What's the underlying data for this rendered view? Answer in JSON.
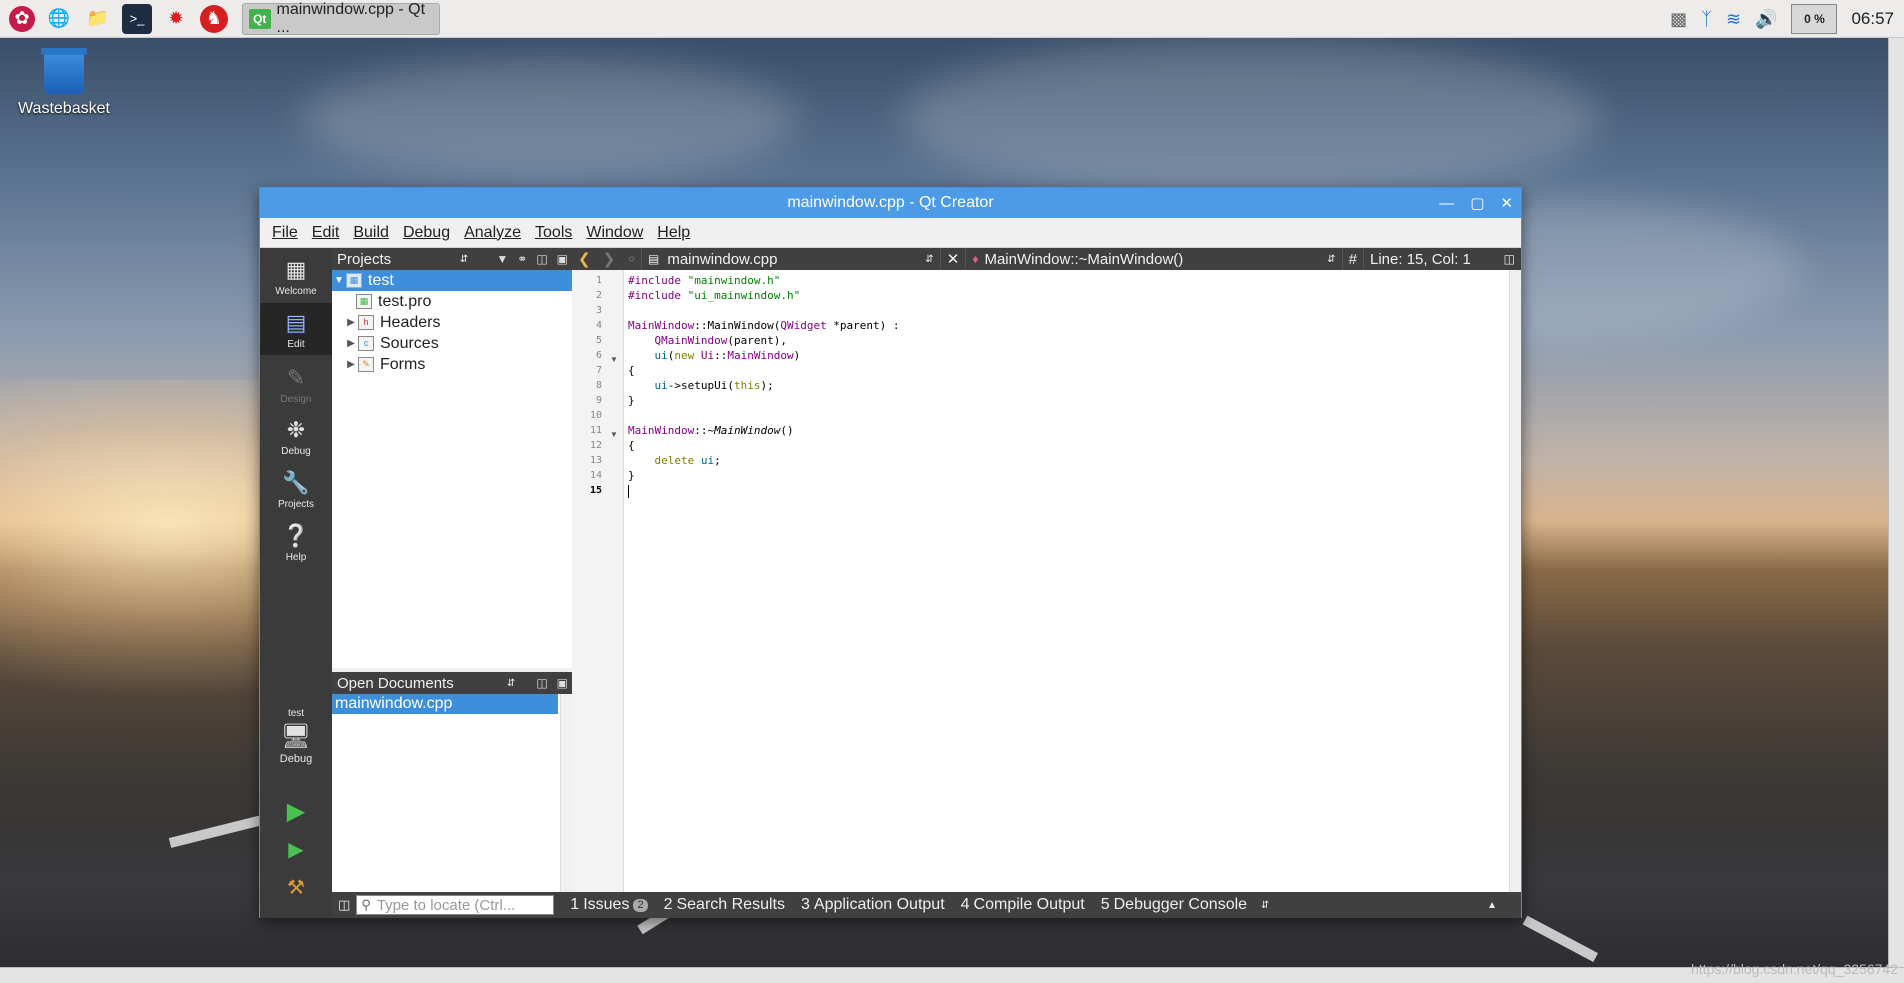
{
  "taskbar": {
    "launchers": [
      "raspberry-menu-icon",
      "web-browser-icon",
      "file-manager-icon",
      "terminal-icon",
      "math-icon",
      "wolfram-icon"
    ],
    "task_icon": "Qt",
    "task_label": "mainwindow.cpp - Qt ...",
    "cpu": "0 %",
    "clock": "06:57"
  },
  "desktop": {
    "icon_label": "Wastebasket"
  },
  "window": {
    "title": "mainwindow.cpp - Qt Creator",
    "menu": [
      "File",
      "Edit",
      "Build",
      "Debug",
      "Analyze",
      "Tools",
      "Window",
      "Help"
    ]
  },
  "modes": [
    {
      "label": "Welcome"
    },
    {
      "label": "Edit"
    },
    {
      "label": "Design"
    },
    {
      "label": "Debug"
    },
    {
      "label": "Projects"
    },
    {
      "label": "Help"
    }
  ],
  "kit": {
    "project": "test",
    "config": "Debug"
  },
  "projects_panel": {
    "title": "Projects",
    "tree": [
      {
        "label": "test"
      },
      {
        "label": "test.pro"
      },
      {
        "label": "Headers"
      },
      {
        "label": "Sources"
      },
      {
        "label": "Forms"
      }
    ]
  },
  "open_docs": {
    "title": "Open Documents",
    "items": [
      "mainwindow.cpp"
    ]
  },
  "editor": {
    "file": "mainwindow.cpp",
    "symbol": "MainWindow::~MainWindow()",
    "hash": "#",
    "position": "Line: 15, Col: 1",
    "line_numbers": [
      "1",
      "2",
      "3",
      "4",
      "5",
      "6",
      "7",
      "8",
      "9",
      "10",
      "11",
      "12",
      "13",
      "14",
      "15"
    ]
  },
  "locator": {
    "placeholder": "Type to locate (Ctrl..."
  },
  "output_tabs": [
    {
      "num": "1",
      "label": "Issues",
      "badge": "2"
    },
    {
      "num": "2",
      "label": "Search Results"
    },
    {
      "num": "3",
      "label": "Application Output"
    },
    {
      "num": "4",
      "label": "Compile Output"
    },
    {
      "num": "5",
      "label": "Debugger Console"
    }
  ],
  "watermark": "https://blog.csdn.net/qq_3256742"
}
